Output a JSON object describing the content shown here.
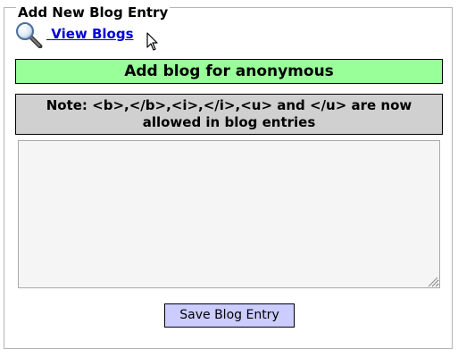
{
  "form": {
    "legend": "Add New Blog Entry",
    "view_link_label": " View Blogs",
    "banner": "Add blog for anonymous",
    "note": "Note: <b>,</b>,<i>,</i>,<u> and </u> are now allowed in blog entries",
    "entry_value": "",
    "save_label": "Save Blog Entry"
  },
  "icons": {
    "view_link_icon": "magnifier-icon",
    "pointer": "mouse-pointer-icon",
    "resize": "resize-grip-icon"
  },
  "colors": {
    "banner_bg": "#99ff99",
    "note_bg": "#d0d0d0",
    "button_bg": "#ccccff",
    "link": "#0000d8"
  }
}
